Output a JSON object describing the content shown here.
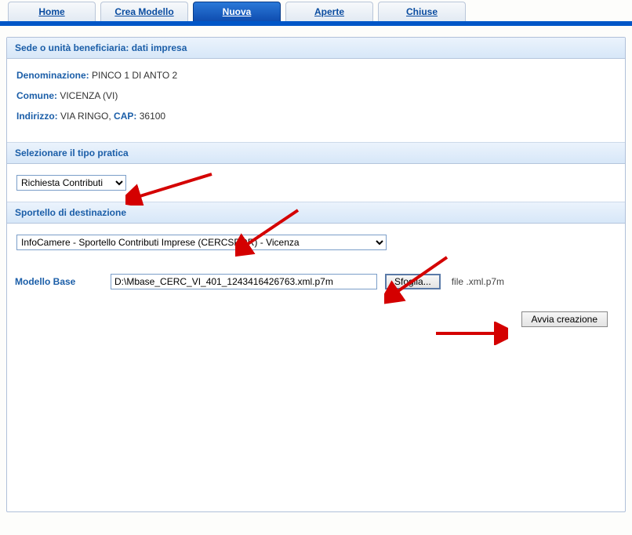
{
  "tabs": [
    {
      "label": "Home",
      "active": false
    },
    {
      "label": "Crea Modello",
      "active": false
    },
    {
      "label": "Nuova",
      "active": true
    },
    {
      "label": "Aperte",
      "active": false
    },
    {
      "label": "Chiuse",
      "active": false
    }
  ],
  "section1": {
    "header": "Sede o unità beneficiaria: dati impresa",
    "denom_label": "Denominazione:",
    "denom_value": "PINCO 1 DI ANTO 2",
    "comune_label": "Comune:",
    "comune_value": "VICENZA  (VI)",
    "indirizzo_label": "Indirizzo:",
    "indirizzo_value": "VIA RINGO, ",
    "cap_label": "CAP:",
    "cap_value": "36100"
  },
  "section2": {
    "header": "Selezionare il tipo pratica",
    "selected": "Richiesta Contributi"
  },
  "section3": {
    "header": "Sportello di destinazione",
    "selected": "InfoCamere - Sportello Contributi Imprese (CERCSPOR) - Vicenza"
  },
  "modello": {
    "label": "Modello Base",
    "value": "D:\\Mbase_CERC_VI_401_1243416426763.xml.p7m",
    "browse": "Sfoglia...",
    "hint": "file .xml.p7m"
  },
  "avvia": {
    "label": "Avvia creazione"
  }
}
